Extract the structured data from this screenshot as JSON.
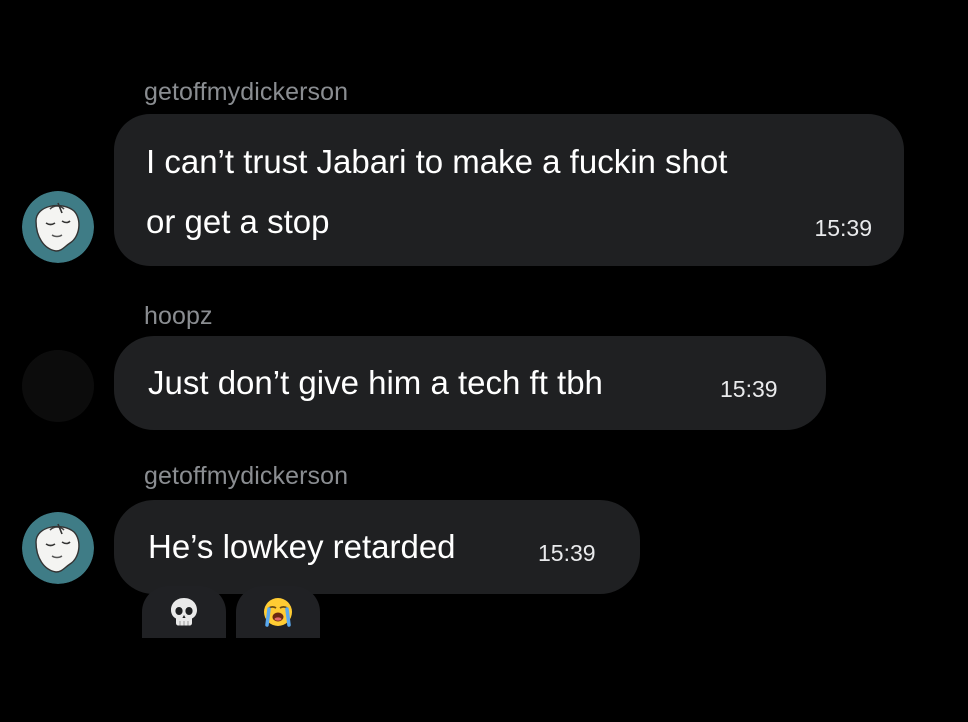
{
  "conversation": {
    "messages": [
      {
        "sender": "getoffmydickerson",
        "line1": "I can’t trust Jabari to make a fuckin shot",
        "line2": "or get a stop",
        "time": "15:39",
        "avatar": "sketch-face-avatar"
      },
      {
        "sender": "hoopz",
        "text": "Just don’t give him a tech ft tbh",
        "time": "15:39",
        "avatar": "dark-placeholder-avatar"
      },
      {
        "sender": "getoffmydickerson",
        "text": "He’s lowkey retarded",
        "time": "15:39",
        "avatar": "sketch-face-avatar"
      }
    ],
    "reactions": [
      {
        "icon": "skull-icon"
      },
      {
        "icon": "loudly-crying-face-icon"
      }
    ]
  },
  "colors": {
    "background": "#000000",
    "bubble": "#1f2022",
    "sender_name": "#8a8d91",
    "avatar_teal": "#3f7c86"
  }
}
